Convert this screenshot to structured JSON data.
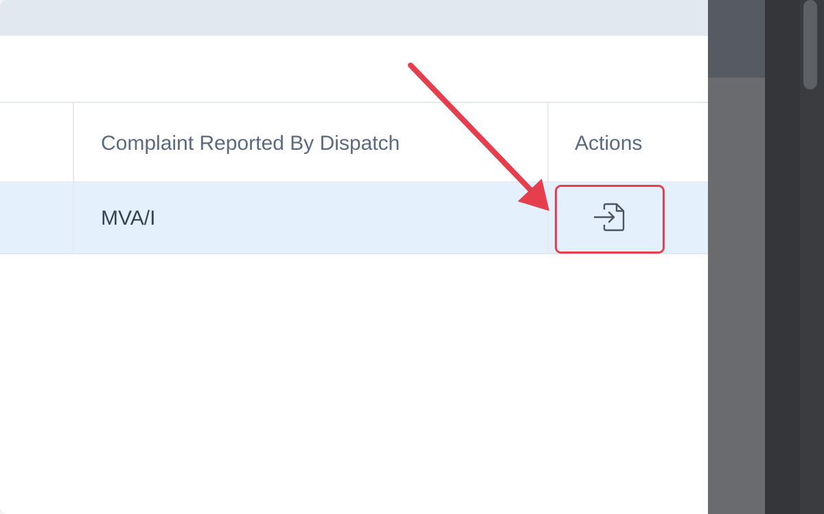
{
  "table": {
    "columns": [
      "Complaint Reported By Dispatch",
      "Actions"
    ],
    "rows": [
      {
        "complaint": "MVA/I",
        "action_icon": "file-import-icon"
      }
    ]
  },
  "colors": {
    "highlight": "#e53e4c",
    "row_selected": "#e4f0fb",
    "header_text": "#5a6a80"
  }
}
